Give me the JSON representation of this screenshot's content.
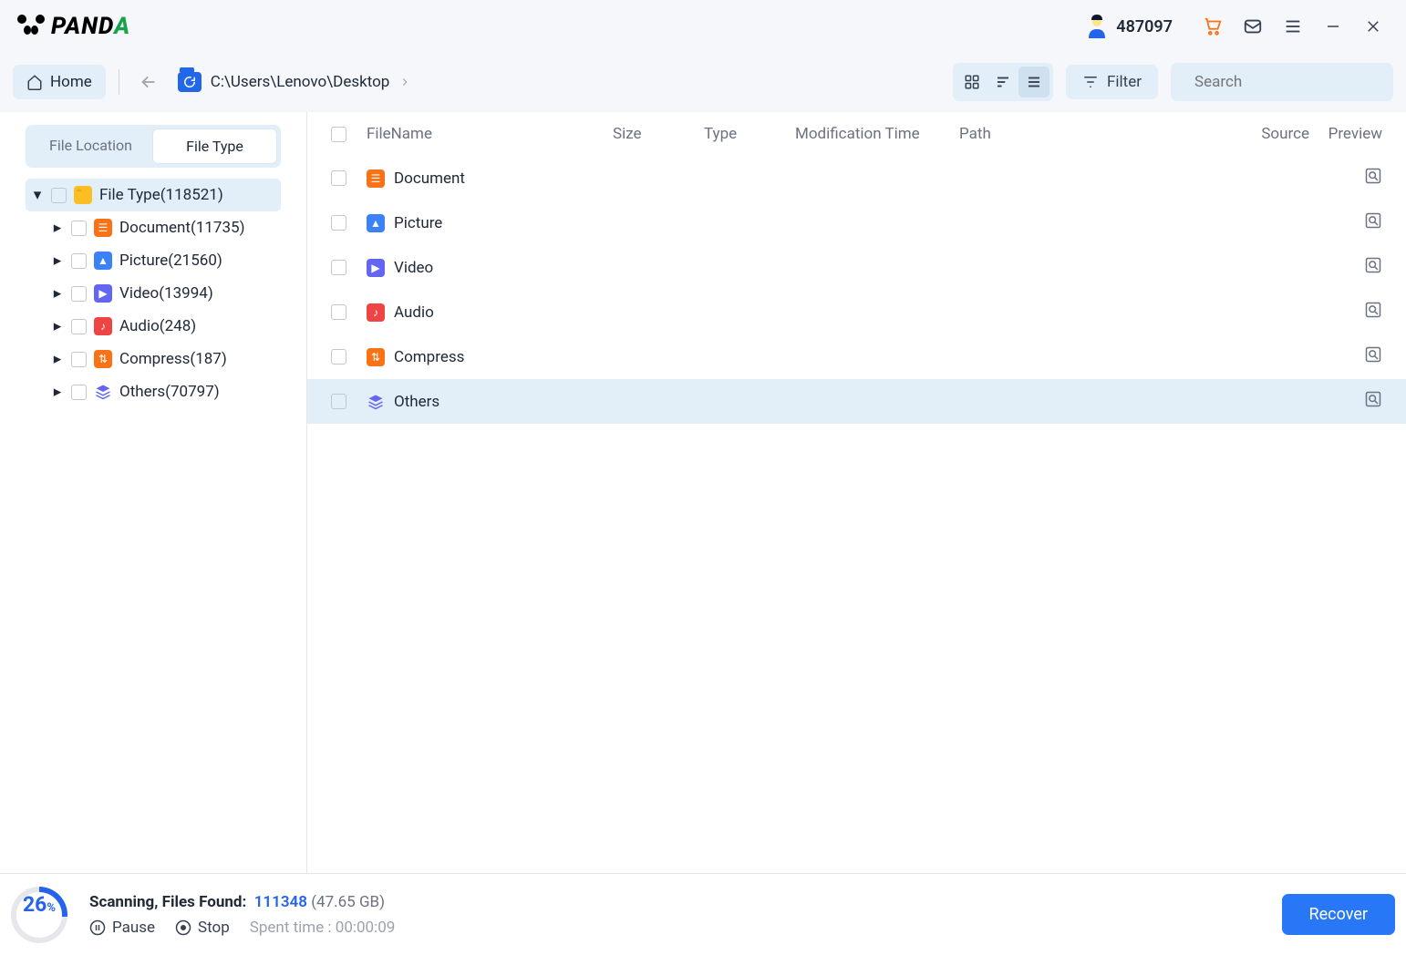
{
  "titlebar": {
    "user_id": "487097"
  },
  "toolbar": {
    "home_label": "Home",
    "path": "C:\\Users\\Lenovo\\Desktop",
    "filter_label": "Filter",
    "search_placeholder": "Search"
  },
  "sidebar": {
    "tabs": {
      "location": "File Location",
      "type": "File Type"
    },
    "root_label": "File Type(118521)",
    "nodes": [
      {
        "label": "Document(11735)"
      },
      {
        "label": "Picture(21560)"
      },
      {
        "label": "Video(13994)"
      },
      {
        "label": "Audio(248)"
      },
      {
        "label": "Compress(187)"
      },
      {
        "label": "Others(70797)"
      }
    ]
  },
  "columns": {
    "name": "FileName",
    "size": "Size",
    "type": "Type",
    "mod": "Modification Time",
    "path": "Path",
    "source": "Source",
    "preview": "Preview"
  },
  "rows": [
    {
      "name": "Document"
    },
    {
      "name": "Picture"
    },
    {
      "name": "Video"
    },
    {
      "name": "Audio"
    },
    {
      "name": "Compress"
    },
    {
      "name": "Others"
    }
  ],
  "footer": {
    "progress": "26",
    "scan_label": "Scanning, Files Found:",
    "found_count": "111348",
    "found_size": "(47.65 GB)",
    "pause": "Pause",
    "stop": "Stop",
    "time_label": "Spent time : 00:00:09",
    "recover": "Recover"
  }
}
